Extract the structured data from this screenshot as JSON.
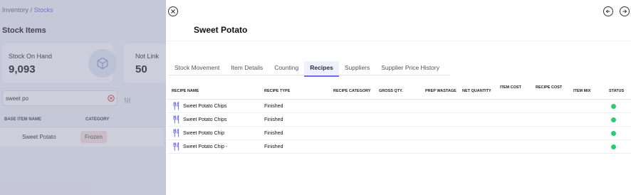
{
  "background": {
    "breadcrumb": {
      "parent": "Inventory",
      "separator": "/",
      "current": "Stocks"
    },
    "page_title": "Stock Items",
    "stats": [
      {
        "label": "Stock On Hand",
        "value": "9,093",
        "icon": "cube-icon"
      },
      {
        "label": "Not Link",
        "value": "50"
      }
    ],
    "search": {
      "value": "sweet po"
    },
    "table": {
      "columns": [
        "BASE ITEM NAME",
        "CATEGORY"
      ],
      "rows": [
        {
          "name": "Sweet Potato",
          "category": "Frozen"
        }
      ]
    }
  },
  "drawer": {
    "title": "Sweet Potato",
    "tabs": [
      {
        "label": "Stock Movement",
        "active": false
      },
      {
        "label": "Item Details",
        "active": false
      },
      {
        "label": "Counting",
        "active": false
      },
      {
        "label": "Recipes",
        "active": true
      },
      {
        "label": "Suppliers",
        "active": false
      },
      {
        "label": "Supplier Price History",
        "active": false
      }
    ],
    "recipes_table": {
      "columns": {
        "recipe_name": "RECIPE NAME",
        "recipe_type": "RECIPE TYPE",
        "recipe_category": "RECIPE CATEGORY",
        "gross_qty": "GROSS QTY.",
        "prep_wastage": "PREP WASTAGE",
        "net_quantity": "NET QUANTITY",
        "item_cost": "ITEM COST",
        "recipe_cost": "RECIPE COST",
        "item_mix": "ITEM MIX",
        "status": "STATUS"
      },
      "rows": [
        {
          "name": "Sweet Potato Chips",
          "type": "Finished",
          "status": "active"
        },
        {
          "name": "Sweet Potato Chips",
          "type": "Finished",
          "status": "active"
        },
        {
          "name": "Sweet Potato Chip",
          "type": "Finished",
          "status": "active"
        },
        {
          "name": "Sweet Potato Chip -",
          "type": "Finished",
          "status": "active"
        }
      ]
    }
  },
  "colors": {
    "accent": "#6d6ee6",
    "status_active": "#2ecc71",
    "recipe_icon": "#6d6ee6",
    "chip_bg": "#f8e4dd"
  },
  "icons": {
    "close": "close-icon",
    "prev": "arrow-left-icon",
    "next": "arrow-right-icon",
    "recipe_row": "utensils-icon",
    "search_clear": "clear-icon",
    "filter": "filter-icon"
  }
}
